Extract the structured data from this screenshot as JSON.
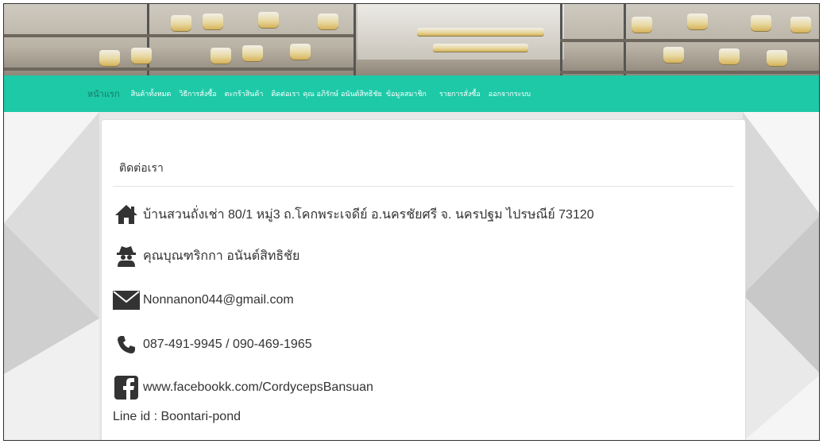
{
  "nav": {
    "items": [
      {
        "label": "หน้าแรก"
      },
      {
        "label": "สินค้าทั้งหมด"
      },
      {
        "label": "วิธีการสั่งซื้อ"
      },
      {
        "label": "ตะกร้าสินค้า"
      },
      {
        "label": "ติดต่อเรา"
      },
      {
        "label": "คุณ อภิรักษ์ อนันต์สิทธิชัย"
      },
      {
        "label": "ข้อมูลสมาชิก"
      },
      {
        "label": "รายการสั่งซื้อ"
      },
      {
        "label": "ออกจากระบบ"
      }
    ]
  },
  "contact": {
    "title": "ติดต่อเรา",
    "address": "บ้านสวนถั่งเช่า 80/1 หมู่3 ถ.โคกพระเจดีย์ อ.นครชัยศรี จ. นครปฐม ไปรษณีย์ 73120",
    "person": "คุณบุณฑริกกา อนันต์สิทธิชัย",
    "email": "Nonnanon044@gmail.com",
    "phone": "087-491-9945 / 090-469-1965",
    "facebook": "www.facebookk.com/CordycepsBansuan",
    "line": "Line id : Boontari-pond"
  },
  "icons": {
    "address": "home-icon",
    "person": "spy-user-icon",
    "email": "envelope-icon",
    "phone": "phone-icon",
    "facebook": "facebook-icon"
  },
  "colors": {
    "navbar": "#1ec9a8",
    "active_nav": "#157a66",
    "icon": "#333333"
  }
}
